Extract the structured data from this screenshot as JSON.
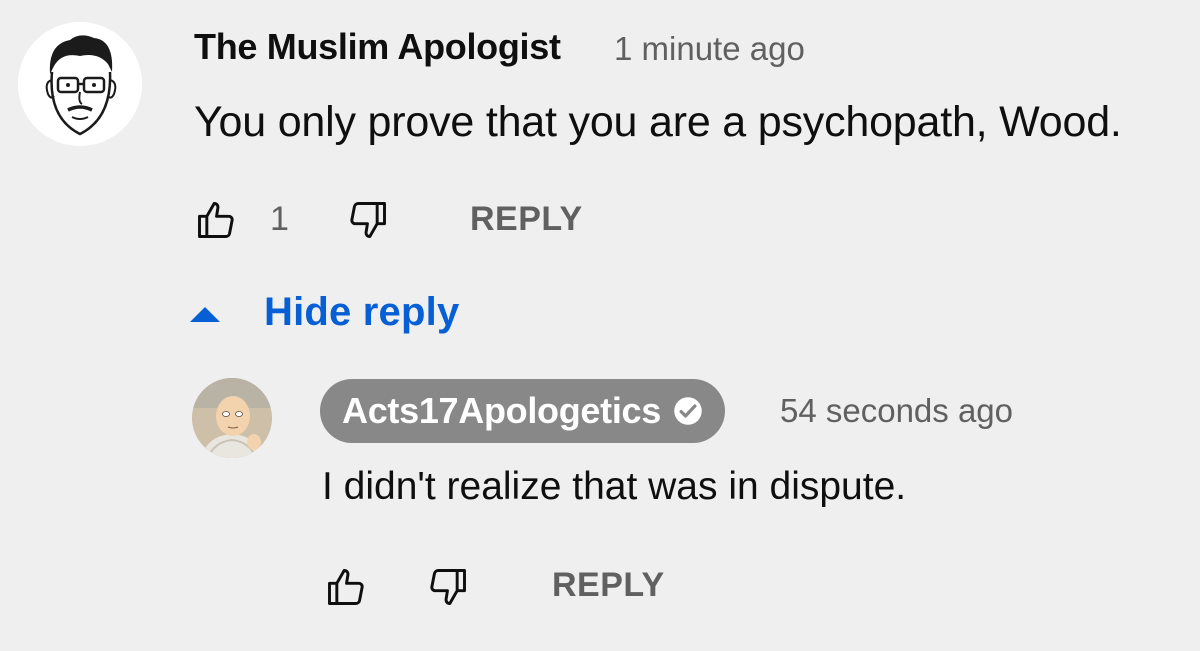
{
  "comment": {
    "author": "The Muslim Apologist",
    "timestamp": "1 minute ago",
    "text": "You only prove that you are a psychopath, Wood.",
    "like_count": "1",
    "reply_label": "REPLY",
    "avatar_icon": "cartoon-face-glasses-avatar"
  },
  "replies_toggle": {
    "label": "Hide reply",
    "icon": "caret-up-icon",
    "color": "#065fd4"
  },
  "reply": {
    "author": "Acts17Apologetics",
    "verified": true,
    "verified_icon": "verified-check-icon",
    "timestamp": "54 seconds ago",
    "text": "I didn't realize that was in dispute.",
    "reply_label": "REPLY",
    "avatar_icon": "anime-character-avatar",
    "author_chip_color": "#888888"
  },
  "colors": {
    "background": "#efefef",
    "secondary_text": "#606060",
    "primary_text": "#0f0f0f",
    "link": "#065fd4"
  }
}
